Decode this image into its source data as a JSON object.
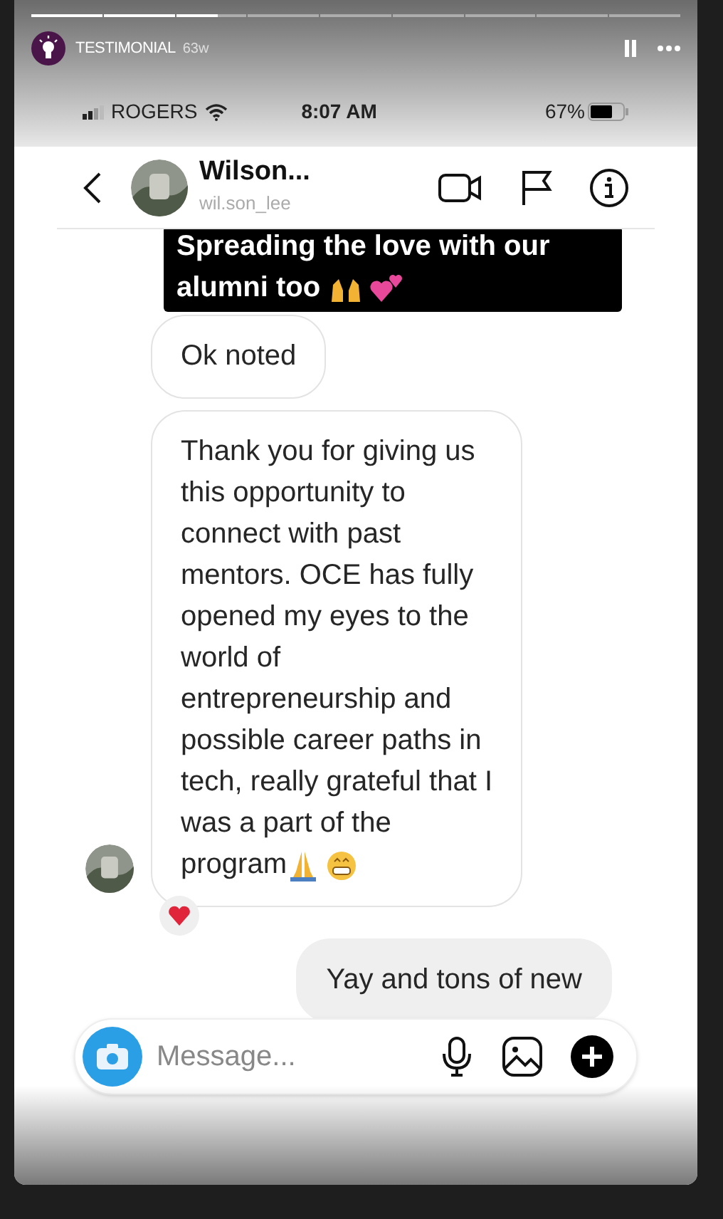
{
  "story": {
    "progress": [
      {
        "viewed": true
      },
      {
        "viewed": true
      },
      {
        "viewed": false,
        "level": 0.6
      },
      {
        "viewed": false
      },
      {
        "viewed": false
      },
      {
        "viewed": false
      },
      {
        "viewed": false
      },
      {
        "viewed": false
      },
      {
        "viewed": false
      }
    ],
    "account": "TESTIMONIAL",
    "age": "63w",
    "paused": true
  },
  "phone_status": {
    "carrier": "ROGERS",
    "time": "8:07 AM",
    "battery": "67%"
  },
  "chat_header": {
    "name": "Wilson...",
    "username": "wil.son_lee"
  },
  "sticker": {
    "text": "Spreading the love with our alumni too"
  },
  "messages": [
    {
      "kind": "received",
      "text": "Ok noted",
      "reacted": false,
      "avatar": false
    },
    {
      "kind": "received",
      "text": "Thank you for giving us\nthis opportunity to\nconnect with past\nmentors. OCE has fully\nopened my eyes to the\nworld of\nentrepreneurship and\npossible  career paths in\ntech, really grateful that I\nwas a part of the\nprogram",
      "reacted": true,
      "avatar": true
    },
    {
      "kind": "sent",
      "text": "Yay and tons of new",
      "reacted": false,
      "avatar": false
    }
  ],
  "composer": {
    "placeholder": "Message..."
  }
}
